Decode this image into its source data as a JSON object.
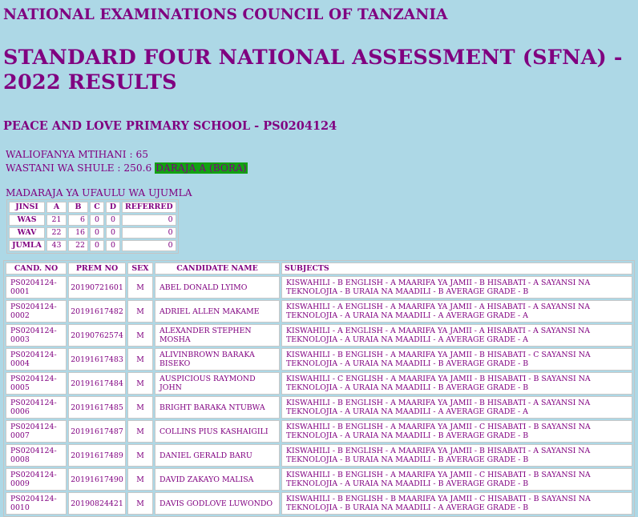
{
  "header": {
    "council": "NATIONAL EXAMINATIONS COUNCIL OF TANZANIA",
    "title": "STANDARD FOUR NATIONAL ASSESSMENT (SFNA) - 2022 RESULTS",
    "school": "PEACE AND LOVE PRIMARY SCHOOL - PS0204124"
  },
  "summary": {
    "waliofanya": "WALIOFANYA MTIHANI : 65",
    "wastani": "WASTANI WA SHULE : 250.6",
    "daraja": "DARAJA A (BORA)",
    "daraja_color": "#12a112"
  },
  "grades": {
    "caption": "MADARAJA YA UFAULU WA UJUMLA",
    "headers": [
      "JINSI",
      "A",
      "B",
      "C",
      "D",
      "REFERRED"
    ],
    "rows": [
      [
        "WAS",
        "21",
        "6",
        "0",
        "0",
        "0"
      ],
      [
        "WAV",
        "22",
        "16",
        "0",
        "0",
        "0"
      ],
      [
        "JUMLA",
        "43",
        "22",
        "0",
        "0",
        "0"
      ]
    ]
  },
  "results": {
    "headers": [
      "CAND. NO",
      "PREM NO",
      "SEX",
      "CANDIDATE NAME",
      "SUBJECTS"
    ],
    "rows": [
      [
        "PS0204124-0001",
        "20190721601",
        "M",
        "ABEL DONALD LYIMO",
        "KISWAHILI - B ENGLISH - A MAARIFA YA JAMII - B HISABATI - A SAYANSI NA TEKNOLOJIA - B URAIA NA MAADILI - B  AVERAGE GRADE - B"
      ],
      [
        "PS0204124-0002",
        "20191617482",
        "M",
        "ADRIEL ALLEN MAKAME",
        "KISWAHILI - A ENGLISH - A MAARIFA YA JAMII - A HISABATI - A SAYANSI NA TEKNOLOJIA - A URAIA NA MAADILI - A  AVERAGE GRADE - A"
      ],
      [
        "PS0204124-0003",
        "20190762574",
        "M",
        "ALEXANDER STEPHEN MOSHA",
        "KISWAHILI - A ENGLISH - A MAARIFA YA JAMII - A HISABATI - A SAYANSI NA TEKNOLOJIA - A URAIA NA MAADILI - A  AVERAGE GRADE - A"
      ],
      [
        "PS0204124-0004",
        "20191617483",
        "M",
        "ALIVINBROWN BARAKA BISEKO",
        "KISWAHILI - B ENGLISH - A MAARIFA YA JAMII - B HISABATI - C SAYANSI NA TEKNOLOJIA - A URAIA NA MAADILI - B  AVERAGE GRADE - B"
      ],
      [
        "PS0204124-0005",
        "20191617484",
        "M",
        "AUSPICIOUS RAYMOND JOHN",
        "KISWAHILI - C ENGLISH - A MAARIFA YA JAMII - B HISABATI - B SAYANSI NA TEKNOLOJIA - A URAIA NA MAADILI - B  AVERAGE GRADE - B"
      ],
      [
        "PS0204124-0006",
        "20191617485",
        "M",
        "BRIGHT BARAKA NTUBWA",
        "KISWAHILI - B ENGLISH - A MAARIFA YA JAMII - B HISABATI - A SAYANSI NA TEKNOLOJIA - A URAIA NA MAADILI - A  AVERAGE GRADE - A"
      ],
      [
        "PS0204124-0007",
        "20191617487",
        "M",
        "COLLINS PIUS KASHAIGILI",
        "KISWAHILI - B ENGLISH - A MAARIFA YA JAMII - C HISABATI - B SAYANSI NA TEKNOLOJIA - A URAIA NA MAADILI - B  AVERAGE GRADE - B"
      ],
      [
        "PS0204124-0008",
        "20191617489",
        "M",
        "DANIEL GERALD BARU",
        "KISWAHILI - B ENGLISH - A MAARIFA YA JAMII - B HISABATI - A SAYANSI NA TEKNOLOJIA - B URAIA NA MAADILI - B  AVERAGE GRADE - B"
      ],
      [
        "PS0204124-0009",
        "20191617490",
        "M",
        "DAVID ZAKAYO MALISA",
        "KISWAHILI - B ENGLISH - A MAARIFA YA JAMII - C HISABATI - B SAYANSI NA TEKNOLOJIA - A URAIA NA MAADILI - B  AVERAGE GRADE - B"
      ],
      [
        "PS0204124-0010",
        "20190824421",
        "M",
        "DAVIS GODLOVE LUWONDO",
        "KISWAHILI - B ENGLISH - B MAARIFA YA JAMII - C HISABATI - B SAYANSI NA TEKNOLOJIA - B URAIA NA MAADILI - A  AVERAGE GRADE - B"
      ]
    ]
  }
}
